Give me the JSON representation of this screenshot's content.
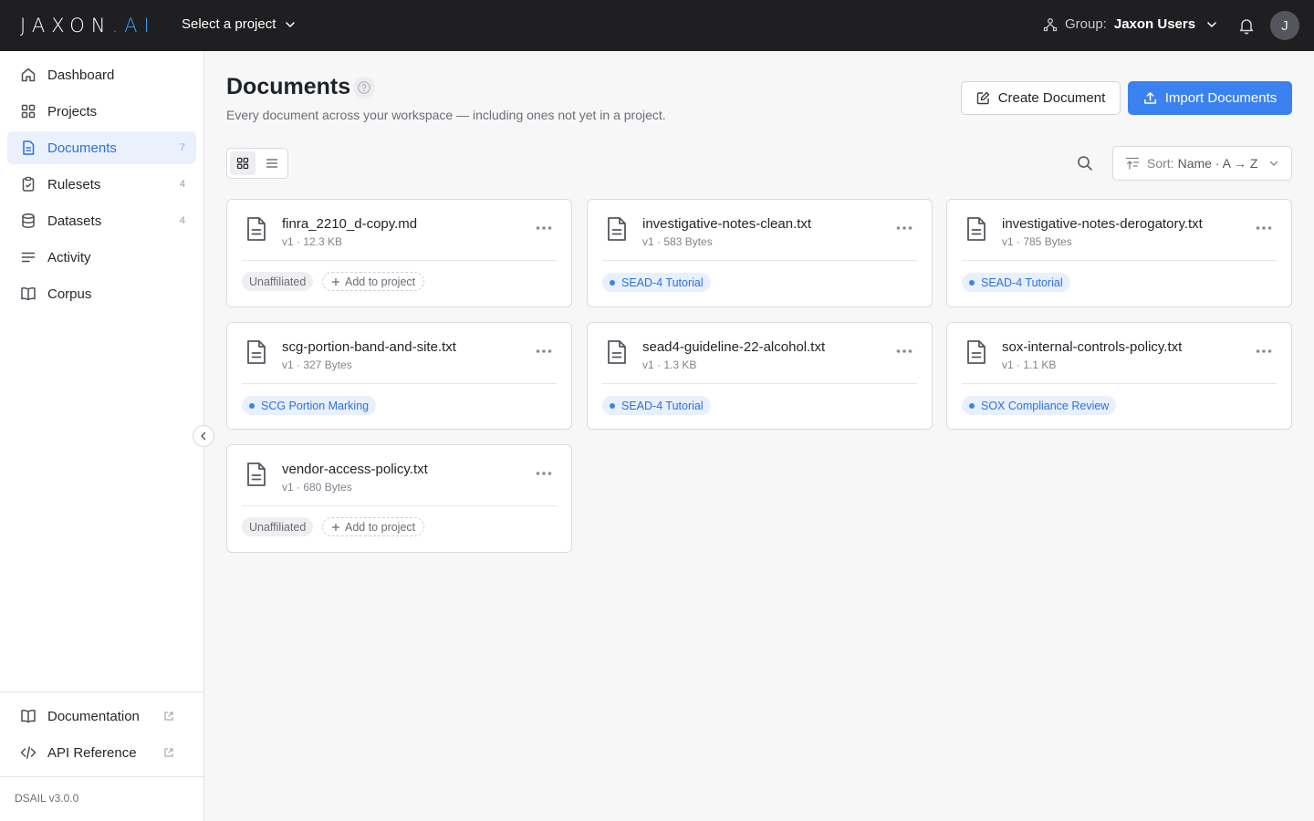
{
  "app": {
    "logo_main": "JAXON",
    "logo_suffix": ".AI",
    "project_select": "Select a project",
    "group_label": "Group:",
    "group_value": "Jaxon Users",
    "avatar_initial": "J"
  },
  "sidebar": {
    "items": [
      {
        "label": "Dashboard",
        "icon": "home-icon",
        "count": ""
      },
      {
        "label": "Projects",
        "icon": "grid-icon",
        "count": ""
      },
      {
        "label": "Documents",
        "icon": "document-icon",
        "count": "7"
      },
      {
        "label": "Rulesets",
        "icon": "clipboard-check-icon",
        "count": "4"
      },
      {
        "label": "Datasets",
        "icon": "database-icon",
        "count": "4"
      },
      {
        "label": "Activity",
        "icon": "list-icon",
        "count": ""
      },
      {
        "label": "Corpus",
        "icon": "book-icon",
        "count": ""
      }
    ],
    "footer_links": [
      {
        "label": "Documentation",
        "icon": "book-icon"
      },
      {
        "label": "API Reference",
        "icon": "code-icon"
      }
    ],
    "version": "DSAIL v3.0.0"
  },
  "page": {
    "title": "Documents",
    "subtitle": "Every document across your workspace — including ones not yet in a project.",
    "create_button": "Create Document",
    "import_button": "Import Documents",
    "sort_label": "Sort:",
    "sort_value": "Name · A → Z"
  },
  "documents": [
    {
      "name": "finra_2210_d-copy.md",
      "meta": "v1 · 12.3 KB",
      "project": "",
      "status": "Unaffiliated",
      "add_label": "Add to project"
    },
    {
      "name": "investigative-notes-clean.txt",
      "meta": "v1 · 583 Bytes",
      "project": "SEAD-4 Tutorial"
    },
    {
      "name": "investigative-notes-derogatory.txt",
      "meta": "v1 · 785 Bytes",
      "project": "SEAD-4 Tutorial"
    },
    {
      "name": "scg-portion-band-and-site.txt",
      "meta": "v1 · 327 Bytes",
      "project": "SCG Portion Marking"
    },
    {
      "name": "sead4-guideline-22-alcohol.txt",
      "meta": "v1 · 1.3 KB",
      "project": "SEAD-4 Tutorial"
    },
    {
      "name": "sox-internal-controls-policy.txt",
      "meta": "v1 · 1.1 KB",
      "project": "SOX Compliance Review"
    },
    {
      "name": "vendor-access-policy.txt",
      "meta": "v1 · 680 Bytes",
      "project": "",
      "status": "Unaffiliated",
      "add_label": "Add to project"
    }
  ],
  "colors": {
    "topbar": "#1f1f22",
    "accent": "#3b82f0",
    "active_nav_bg": "#eaf1fd"
  }
}
